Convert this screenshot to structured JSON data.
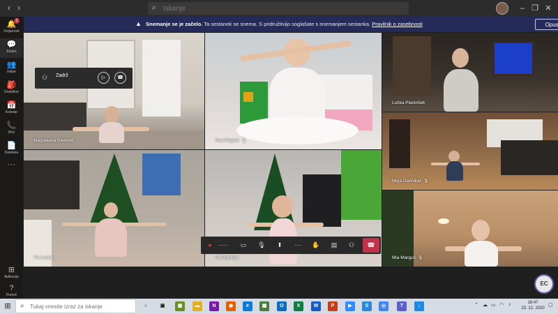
{
  "titlebar": {
    "back_icon": "chevron-left-icon",
    "forward_icon": "chevron-right-icon",
    "search_placeholder": "Iskanje",
    "minimize_glyph": "–",
    "maximize_glyph": "❐",
    "close_glyph": "✕"
  },
  "rail": {
    "items": [
      {
        "label": "Dejavnost",
        "icon": "bell-icon",
        "glyph": "🔔",
        "badge": "2"
      },
      {
        "label": "Klepet",
        "icon": "chat-icon",
        "glyph": "💬"
      },
      {
        "label": "Ekipe",
        "icon": "teams-icon",
        "glyph": "👥"
      },
      {
        "label": "Dodelitve",
        "icon": "assignments-icon",
        "glyph": "🎒"
      },
      {
        "label": "Koledar",
        "icon": "calendar-icon",
        "glyph": "📅"
      },
      {
        "label": "Klici",
        "icon": "phone-icon",
        "glyph": "📞"
      },
      {
        "label": "Datoteke",
        "icon": "files-icon",
        "glyph": "📄"
      },
      {
        "label": "",
        "icon": "more-icon",
        "glyph": "···"
      }
    ],
    "bottom": [
      {
        "label": "Aplikacije",
        "icon": "apps-icon",
        "glyph": "⊞"
      },
      {
        "label": "Pomoč",
        "icon": "help-icon",
        "glyph": "?"
      }
    ]
  },
  "banner": {
    "title": "Snemanje se je začelo.",
    "message": "Ta sestanek se snema. S pridružitvijo soglašate s snemanjem sestanka.",
    "link": "Pravilnik o zasebnosti",
    "dismiss_label": "Opusti",
    "accent": "#242b59"
  },
  "mini_panel": {
    "title": "Zadrž",
    "play_glyph": "▷",
    "hangup_glyph": "☎"
  },
  "participants": [
    {
      "name": "Magdalena Pavlović",
      "mic": ""
    },
    {
      "name": "Tina Flajšak",
      "mic": "🎙"
    },
    {
      "name": "Lučka Planinšek",
      "mic": ""
    },
    {
      "name": "Meja Gačnikar",
      "mic": "🎙"
    },
    {
      "name": "Tia Lučnik",
      "mic": ""
    },
    {
      "name": "Tia Dolničar",
      "mic": ""
    },
    {
      "name": "Mia Marguč",
      "mic": "🎙"
    }
  ],
  "callbar": {
    "timer": "——",
    "buttons": [
      "camera-icon",
      "mic-icon",
      "share-screen-icon",
      "more-actions-icon",
      "raise-hand-icon",
      "chat-icon",
      "participants-icon"
    ]
  },
  "me": {
    "initials": "EC"
  },
  "taskbar": {
    "search_placeholder": "Tukaj vnesite izraz za iskanje",
    "time": "16:47",
    "date": "23. 12. 2020"
  }
}
